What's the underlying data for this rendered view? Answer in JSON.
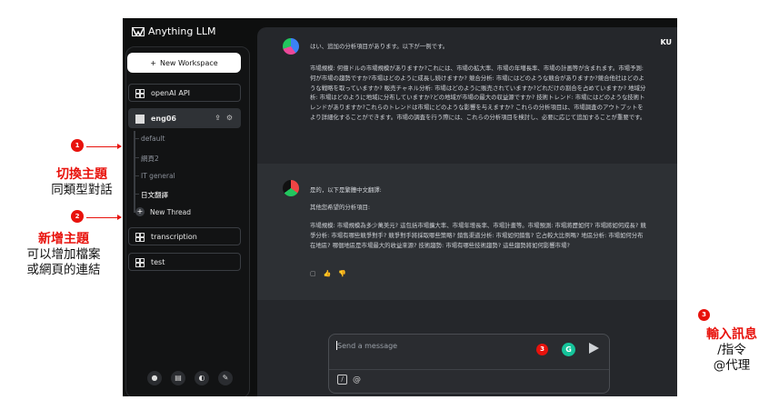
{
  "app": {
    "title": "Anything LLM",
    "new_workspace_label": "New Workspace",
    "workspaces": [
      {
        "label": "openAI API"
      },
      {
        "label": "eng06"
      },
      {
        "label": "transcription"
      },
      {
        "label": "test"
      }
    ],
    "threads": [
      {
        "label": "default"
      },
      {
        "label": "網頁2"
      },
      {
        "label": "IT general"
      },
      {
        "label": "日文翻譯"
      }
    ],
    "new_thread_label": "New Thread",
    "user_badge": "KU",
    "messages": [
      {
        "text": "はい、追加の分析項目があります。以下が一例です。",
        "body": "市場規模: 何億ドルの市場規模がありますか?これには、市場の拡大率、市場の年増長率、市場の計画等が含まれます。市場予測: 何が市場の趨勢ですか?市場はどのように成長し続けますか? 競合分析: 市場にはどのような競合がありますか?競合他社はどのような戦略を取っていますか? 販売チャネル分析: 市場はどのように販売されていますか?どれだけの割合を占めていますか? 地域分析: 市場はどのように地域に分布していますか?どの地域が市場の最大の収益源ですか? 技術トレンド: 市場にはどのような技術トレンドがありますか?これらのトレンドは市場にどのような影響を与えますか? これらの分析項目は、市場調査のアウトプットをより詳細化することができます。市場の調査を行う際には、これらの分析項目を検討し、必要に応じて追加することが重要です。"
      },
      {
        "text": "是的，以下是繁體中文翻譯:",
        "intro": "其他您希望的分析項目:",
        "body": "市場規模: 市場規模為多少萬美元? 這包括市場擴大率、市場年增長率、市場計畫等。市場預測: 市場將歷如何? 市場將如何成長? 競爭分析: 市場有哪些競爭對手? 競爭對手將採取哪些策略? 銷售渠道分析: 市場如何銷售? 它占較大比例嗎? 地區分析: 市場如何分布在地區? 哪個地區是市場最大的收益來源? 技術趨勢: 市場有哪些技術趨勢? 這些趨勢將如何影響市場?"
      }
    ],
    "input_placeholder": "Send a message",
    "input_at": "@",
    "input_slash": "/"
  },
  "annotations": {
    "one": {
      "num": "1",
      "title": "切換主題",
      "sub": "同類型對話"
    },
    "two": {
      "num": "2",
      "title": "新增主題",
      "sub1": "可以增加檔案",
      "sub2": "或網頁的連結"
    },
    "three": {
      "num": "3",
      "title": "輸入訊息",
      "sub1": "/指令",
      "sub2": "@代理"
    }
  },
  "colors": {
    "accent_red": "#e8120c",
    "app_bg": "#0e0f0f",
    "panel_bg": "#25272b",
    "grammarly": "#15c39a"
  }
}
